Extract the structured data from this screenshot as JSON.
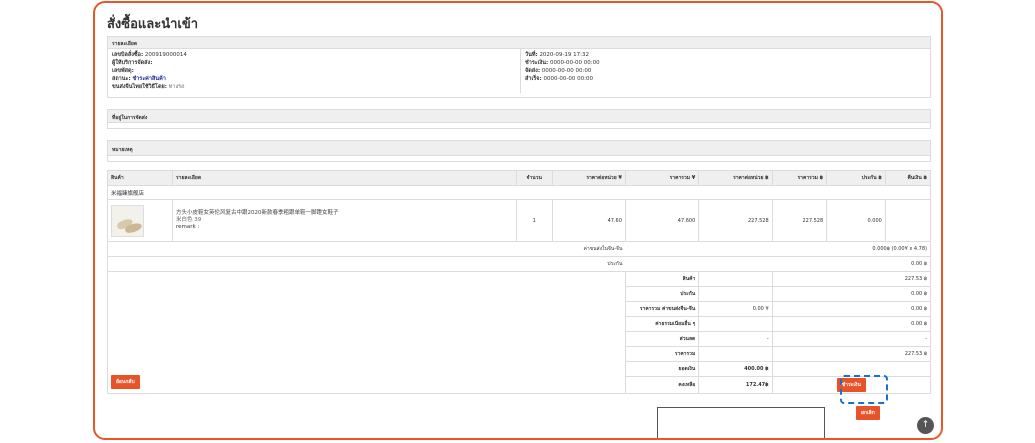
{
  "page": {
    "title": "สั่งซื้อและนำเข้า"
  },
  "details": {
    "header": "รายละเอียด",
    "left": [
      {
        "label": "เลขบิลสั่งซื้อ:",
        "value": "200919000014"
      },
      {
        "label": "ผู้ให้บริการจัดส่ง:",
        "value": ""
      },
      {
        "label": "เลขพัสดุ:",
        "value": ""
      },
      {
        "label": "สถานะ:",
        "value": "ชำระค่าสินค้า"
      },
      {
        "label": "ขนส่งจีนไทยใช้วิธีโดย:",
        "value": "ทางรถ"
      }
    ],
    "right": [
      {
        "label": "วันที่:",
        "value": "2020-09-19 17:32"
      },
      {
        "label": "ชำระเงิน:",
        "value": "0000-00-00 00:00"
      },
      {
        "label": "จัดส่ง:",
        "value": "0000-00-00 00:00"
      },
      {
        "label": "สำเร็จ:",
        "value": "0000-00-00 00:00"
      }
    ]
  },
  "shipping": {
    "header": "ที่อยู่ในการจัดส่ง"
  },
  "notes": {
    "header": "หมายเหตุ"
  },
  "table": {
    "columns": [
      "สินค้า",
      "รายละเอียด",
      "จำนวน",
      "ราคาต่อหน่วย ¥",
      "ราคารวม ¥",
      "ราคาต่อหน่วย ฿",
      "ราคารวม ฿",
      "ประกัน ฿",
      "คืนเงิน ฿"
    ],
    "shop_name": "米福臻旗舰店",
    "item": {
      "name": "方头小皮鞋女英伦风复古中跟2020新款春季粗跟单鞋一脚蹬女鞋子",
      "variant": "米白色 39",
      "remark": "remark :",
      "qty": "1",
      "unit_cny": "47.60",
      "total_cny": "47.600",
      "unit_thb": "227.528",
      "total_thb": "227.528",
      "insurance": "0.000",
      "refund": ""
    },
    "china_shipping": {
      "label": "ค่าขนส่งในจีน-จีน",
      "value": "0.000฿ (0.00¥ x 4.78)"
    },
    "insurance_row": {
      "label": "ประกัน",
      "value": "0.00 ฿"
    },
    "summary": [
      {
        "label": "สินค้า",
        "mid": "",
        "value": "227.53 ฿"
      },
      {
        "label": "ประกัน",
        "mid": "",
        "value": "0.00 ฿"
      },
      {
        "label": "ราคารวม ค่าขนส่งจีน-จีน",
        "mid": "0.00 ¥",
        "value": "0.00 ฿"
      },
      {
        "label": "ค่าธรรมเนียมอื่น ๆ",
        "mid": "",
        "value": "0.00 ฿"
      },
      {
        "label": "ส่วนลด",
        "mid": "-",
        "value": "-"
      },
      {
        "label": "ราคารวม",
        "mid": "",
        "value": "227.53 ฿"
      }
    ],
    "balance": {
      "label": "ยอดเงิน",
      "value": "400.00 ฿"
    },
    "remaining": {
      "label": "คงเหลือ",
      "value": "172.47฿"
    }
  },
  "buttons": {
    "back": "ย้อนกลับ",
    "pay": "ชำระเงิน",
    "cancel": "ยกเลิก"
  },
  "icons": {
    "scroll_top": "↑"
  },
  "colors": {
    "accent": "#e8542a",
    "highlight": "#1b6fd1",
    "green": "#0a8a0a"
  }
}
